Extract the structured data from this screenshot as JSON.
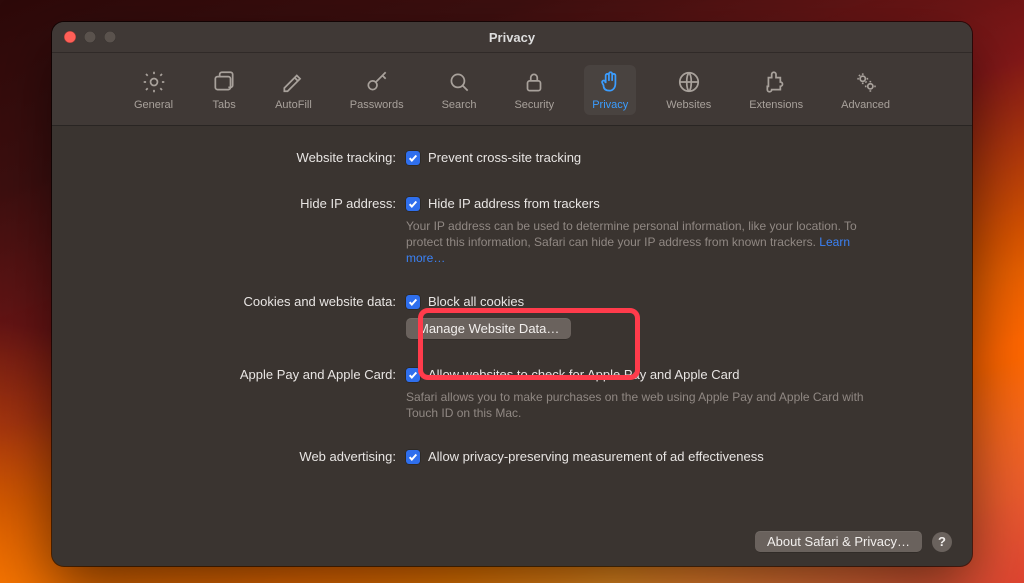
{
  "window": {
    "title": "Privacy"
  },
  "toolbar": {
    "tabs": [
      {
        "id": "general",
        "label": "General"
      },
      {
        "id": "tabs",
        "label": "Tabs"
      },
      {
        "id": "autofill",
        "label": "AutoFill"
      },
      {
        "id": "passwords",
        "label": "Passwords"
      },
      {
        "id": "search",
        "label": "Search"
      },
      {
        "id": "security",
        "label": "Security"
      },
      {
        "id": "privacy",
        "label": "Privacy",
        "active": true
      },
      {
        "id": "websites",
        "label": "Websites"
      },
      {
        "id": "extensions",
        "label": "Extensions"
      },
      {
        "id": "advanced",
        "label": "Advanced"
      }
    ]
  },
  "sections": {
    "tracking": {
      "label": "Website tracking:",
      "option": "Prevent cross-site tracking"
    },
    "hideip": {
      "label": "Hide IP address:",
      "option": "Hide IP address from trackers",
      "desc": "Your IP address can be used to determine personal information, like your location. To protect this information, Safari can hide your IP address from known trackers. ",
      "learn": "Learn more…"
    },
    "cookies": {
      "label": "Cookies and website data:",
      "option": "Block all cookies",
      "manage_btn": "Manage Website Data…"
    },
    "applepay": {
      "label": "Apple Pay and Apple Card:",
      "option": "Allow websites to check for Apple Pay and Apple Card",
      "desc": "Safari allows you to make purchases on the web using Apple Pay and Apple Card with Touch ID on this Mac."
    },
    "webad": {
      "label": "Web advertising:",
      "option": "Allow privacy-preserving measurement of ad effectiveness"
    }
  },
  "footer": {
    "about_btn": "About Safari & Privacy…",
    "help": "?"
  },
  "annotation": {
    "highlight_target": "cookies-section"
  }
}
